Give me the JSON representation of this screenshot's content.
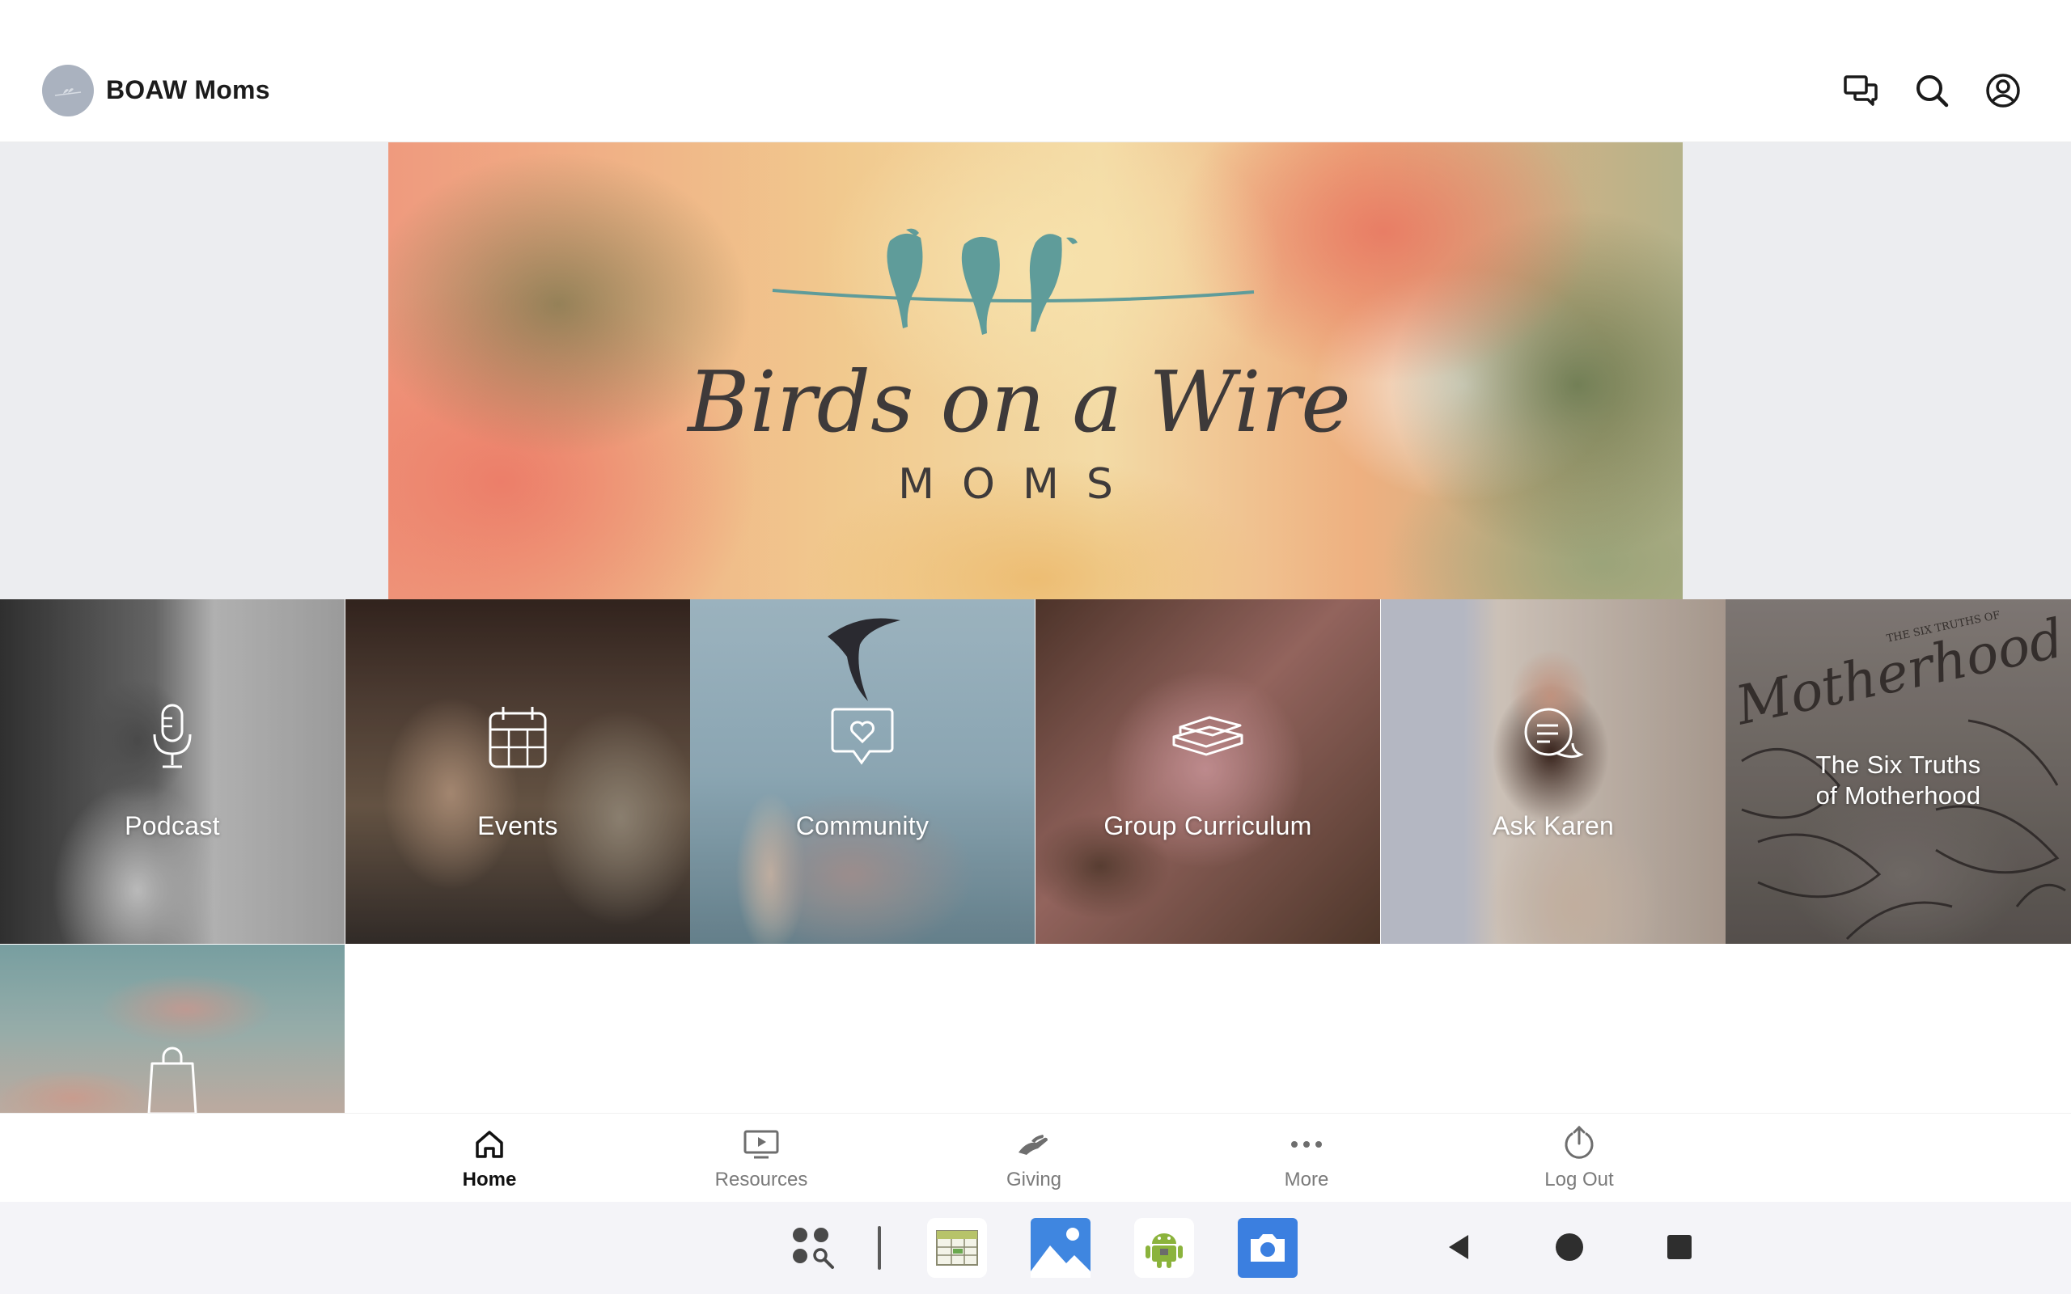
{
  "header": {
    "app_title": "BOAW Moms",
    "icons": [
      "avatar-logo",
      "chat-icon",
      "search-icon",
      "account-icon"
    ]
  },
  "hero": {
    "logo_title": "Birds on a Wire",
    "logo_subtitle": "MOMS"
  },
  "tiles": [
    {
      "label": "Podcast",
      "icon": "microphone-icon"
    },
    {
      "label": "Events",
      "icon": "calendar-icon"
    },
    {
      "label": "Community",
      "icon": "heart-chat-icon"
    },
    {
      "label": "Group Curriculum",
      "icon": "books-icon"
    },
    {
      "label": "Ask Karen",
      "icon": "speech-bubble-icon"
    },
    {
      "label_line1": "The Six Truths",
      "label_line2": "of Motherhood",
      "cover_text_small": "THE SIX TRUTHS OF",
      "cover_text_script": "Motherhood"
    },
    {
      "label": "",
      "icon": "shopping-bag-icon"
    }
  ],
  "bottom_nav": {
    "items": [
      {
        "label": "Home",
        "icon": "home-icon",
        "active": true
      },
      {
        "label": "Resources",
        "icon": "monitor-play-icon",
        "active": false
      },
      {
        "label": "Giving",
        "icon": "giving-hand-icon",
        "active": false
      },
      {
        "label": "More",
        "icon": "more-dots-icon",
        "active": false
      },
      {
        "label": "Log Out",
        "icon": "power-icon",
        "active": false
      }
    ]
  },
  "system_bar": {
    "icons": [
      "app-drawer-search-icon",
      "spreadsheet-app-icon",
      "gallery-app-icon",
      "android-app-icon",
      "camera-app-icon",
      "back-icon",
      "home-circle-icon",
      "recents-icon"
    ]
  },
  "colors": {
    "teal_bird": "#5f9c9a",
    "logo_text": "#3e3a3a",
    "nav_active": "#111111",
    "nav_inactive": "#7a7a7a"
  }
}
